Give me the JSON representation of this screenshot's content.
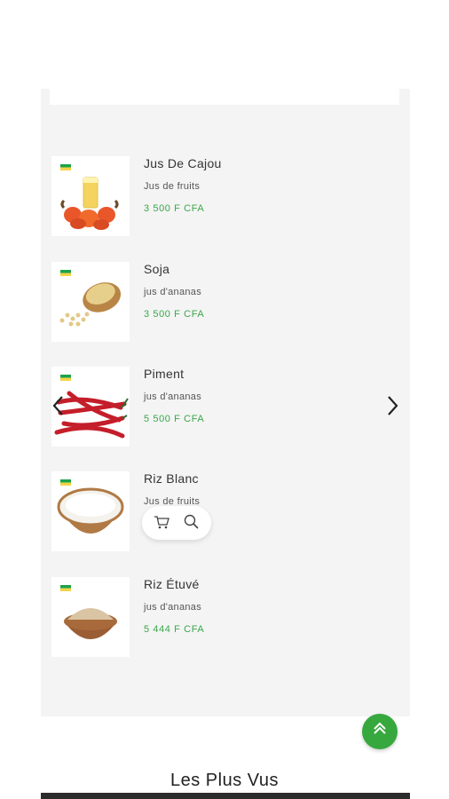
{
  "products": [
    {
      "name": "Jus De Cajou",
      "category": "Jus de fruits",
      "price": "3 500 F CFA",
      "image": "cashew-juice-image"
    },
    {
      "name": "Soja",
      "category": "jus d'ananas",
      "price": "3 500 F CFA",
      "image": "soy-beans-image"
    },
    {
      "name": "Piment",
      "category": "jus d'ananas",
      "price": "5 500 F CFA",
      "image": "chili-peppers-image"
    },
    {
      "name": "Riz Blanc",
      "category": "Jus de fruits",
      "price": "",
      "image": "white-rice-image"
    },
    {
      "name": "Riz Étuvé",
      "category": "jus d'ananas",
      "price": "5 444 F CFA",
      "image": "parboiled-rice-image"
    }
  ],
  "carousel": {
    "prev_icon": "chevron-left-icon",
    "next_icon": "chevron-right-icon"
  },
  "quick_actions": {
    "cart_icon": "cart-icon",
    "search_icon": "search-icon"
  },
  "scroll_top": {
    "icon": "double-chevron-up-icon"
  },
  "section": {
    "title": "Les Plus Vus"
  },
  "colors": {
    "price": "#3aa84a",
    "accent_button": "#37a83d",
    "panel_bg": "#f4f4f4"
  }
}
